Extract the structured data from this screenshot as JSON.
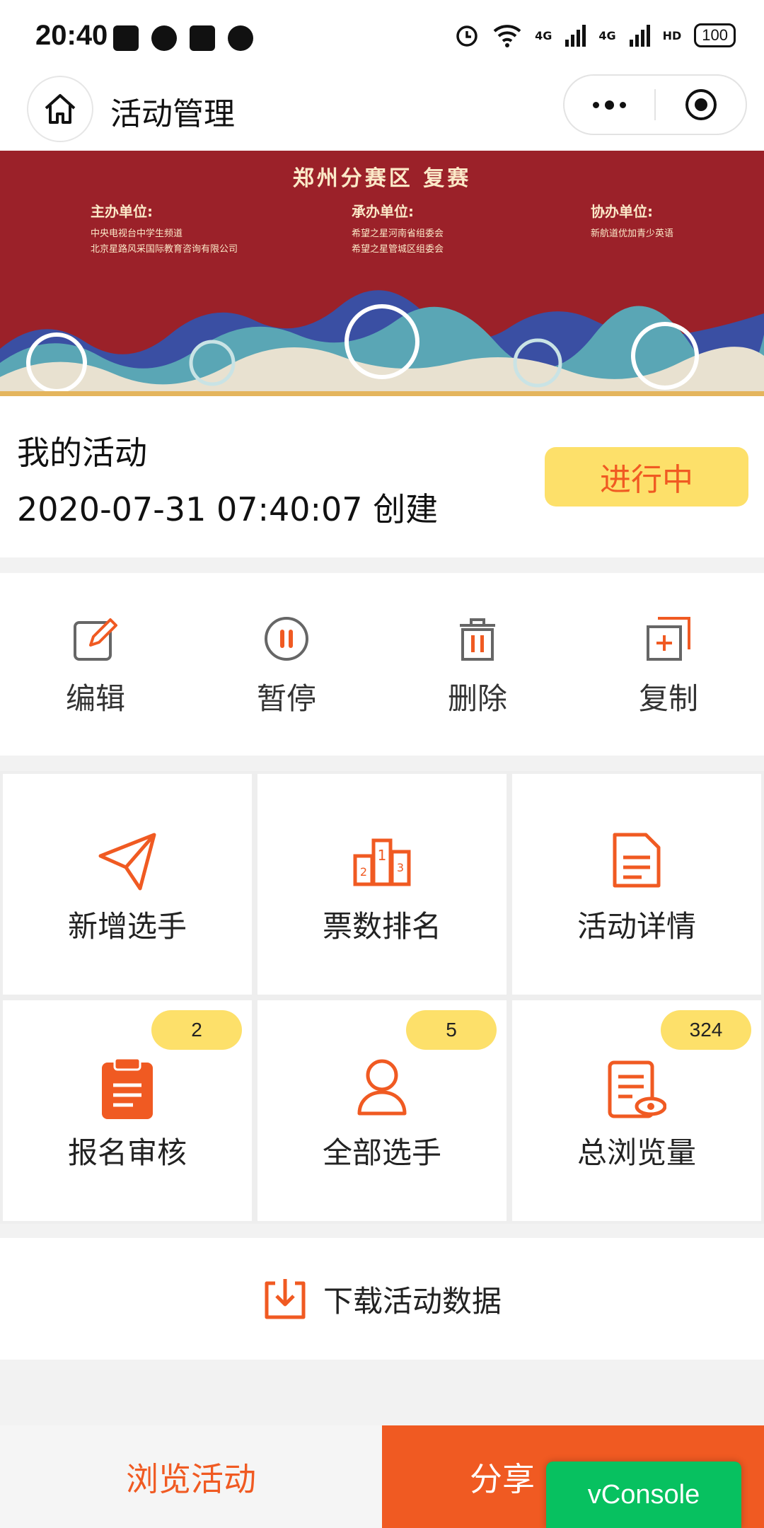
{
  "status_bar": {
    "time": "20:40",
    "battery": "100",
    "net1": "4G",
    "net2": "4G",
    "hd": "HD"
  },
  "nav": {
    "title": "活动管理"
  },
  "banner": {
    "title": "郑州分赛区 复赛",
    "host_label": "主办单位:",
    "host_lines": [
      "中央电视台中学生频道",
      "北京星路风采国际教育咨询有限公司"
    ],
    "organizer_label": "承办单位:",
    "organizer_lines": [
      "希望之星河南省组委会",
      "希望之星管城区组委会"
    ],
    "co_label": "协办单位:",
    "co_lines": [
      "新航道优加青少英语"
    ]
  },
  "activity": {
    "name": "我的活动",
    "created": "2020-07-31 07:40:07 创建",
    "status": "进行中"
  },
  "actions": [
    {
      "label": "编辑",
      "icon": "edit-icon"
    },
    {
      "label": "暂停",
      "icon": "pause-icon"
    },
    {
      "label": "删除",
      "icon": "delete-icon"
    },
    {
      "label": "复制",
      "icon": "copy-icon"
    }
  ],
  "grid": [
    {
      "label": "新增选手",
      "icon": "paper-plane-icon",
      "badge": ""
    },
    {
      "label": "票数排名",
      "icon": "podium-icon",
      "badge": ""
    },
    {
      "label": "活动详情",
      "icon": "document-icon",
      "badge": ""
    },
    {
      "label": "报名审核",
      "icon": "clipboard-icon",
      "badge": "2"
    },
    {
      "label": "全部选手",
      "icon": "user-icon",
      "badge": "5"
    },
    {
      "label": "总浏览量",
      "icon": "view-doc-icon",
      "badge": "324"
    }
  ],
  "download": {
    "label": "下载活动数据"
  },
  "bottom": {
    "browse": "浏览活动",
    "share": "分享"
  },
  "vconsole": "vConsole",
  "colors": {
    "accent": "#f05a22",
    "badge": "#fde06a",
    "banner": "#9b2129",
    "vconsole": "#07c160"
  }
}
